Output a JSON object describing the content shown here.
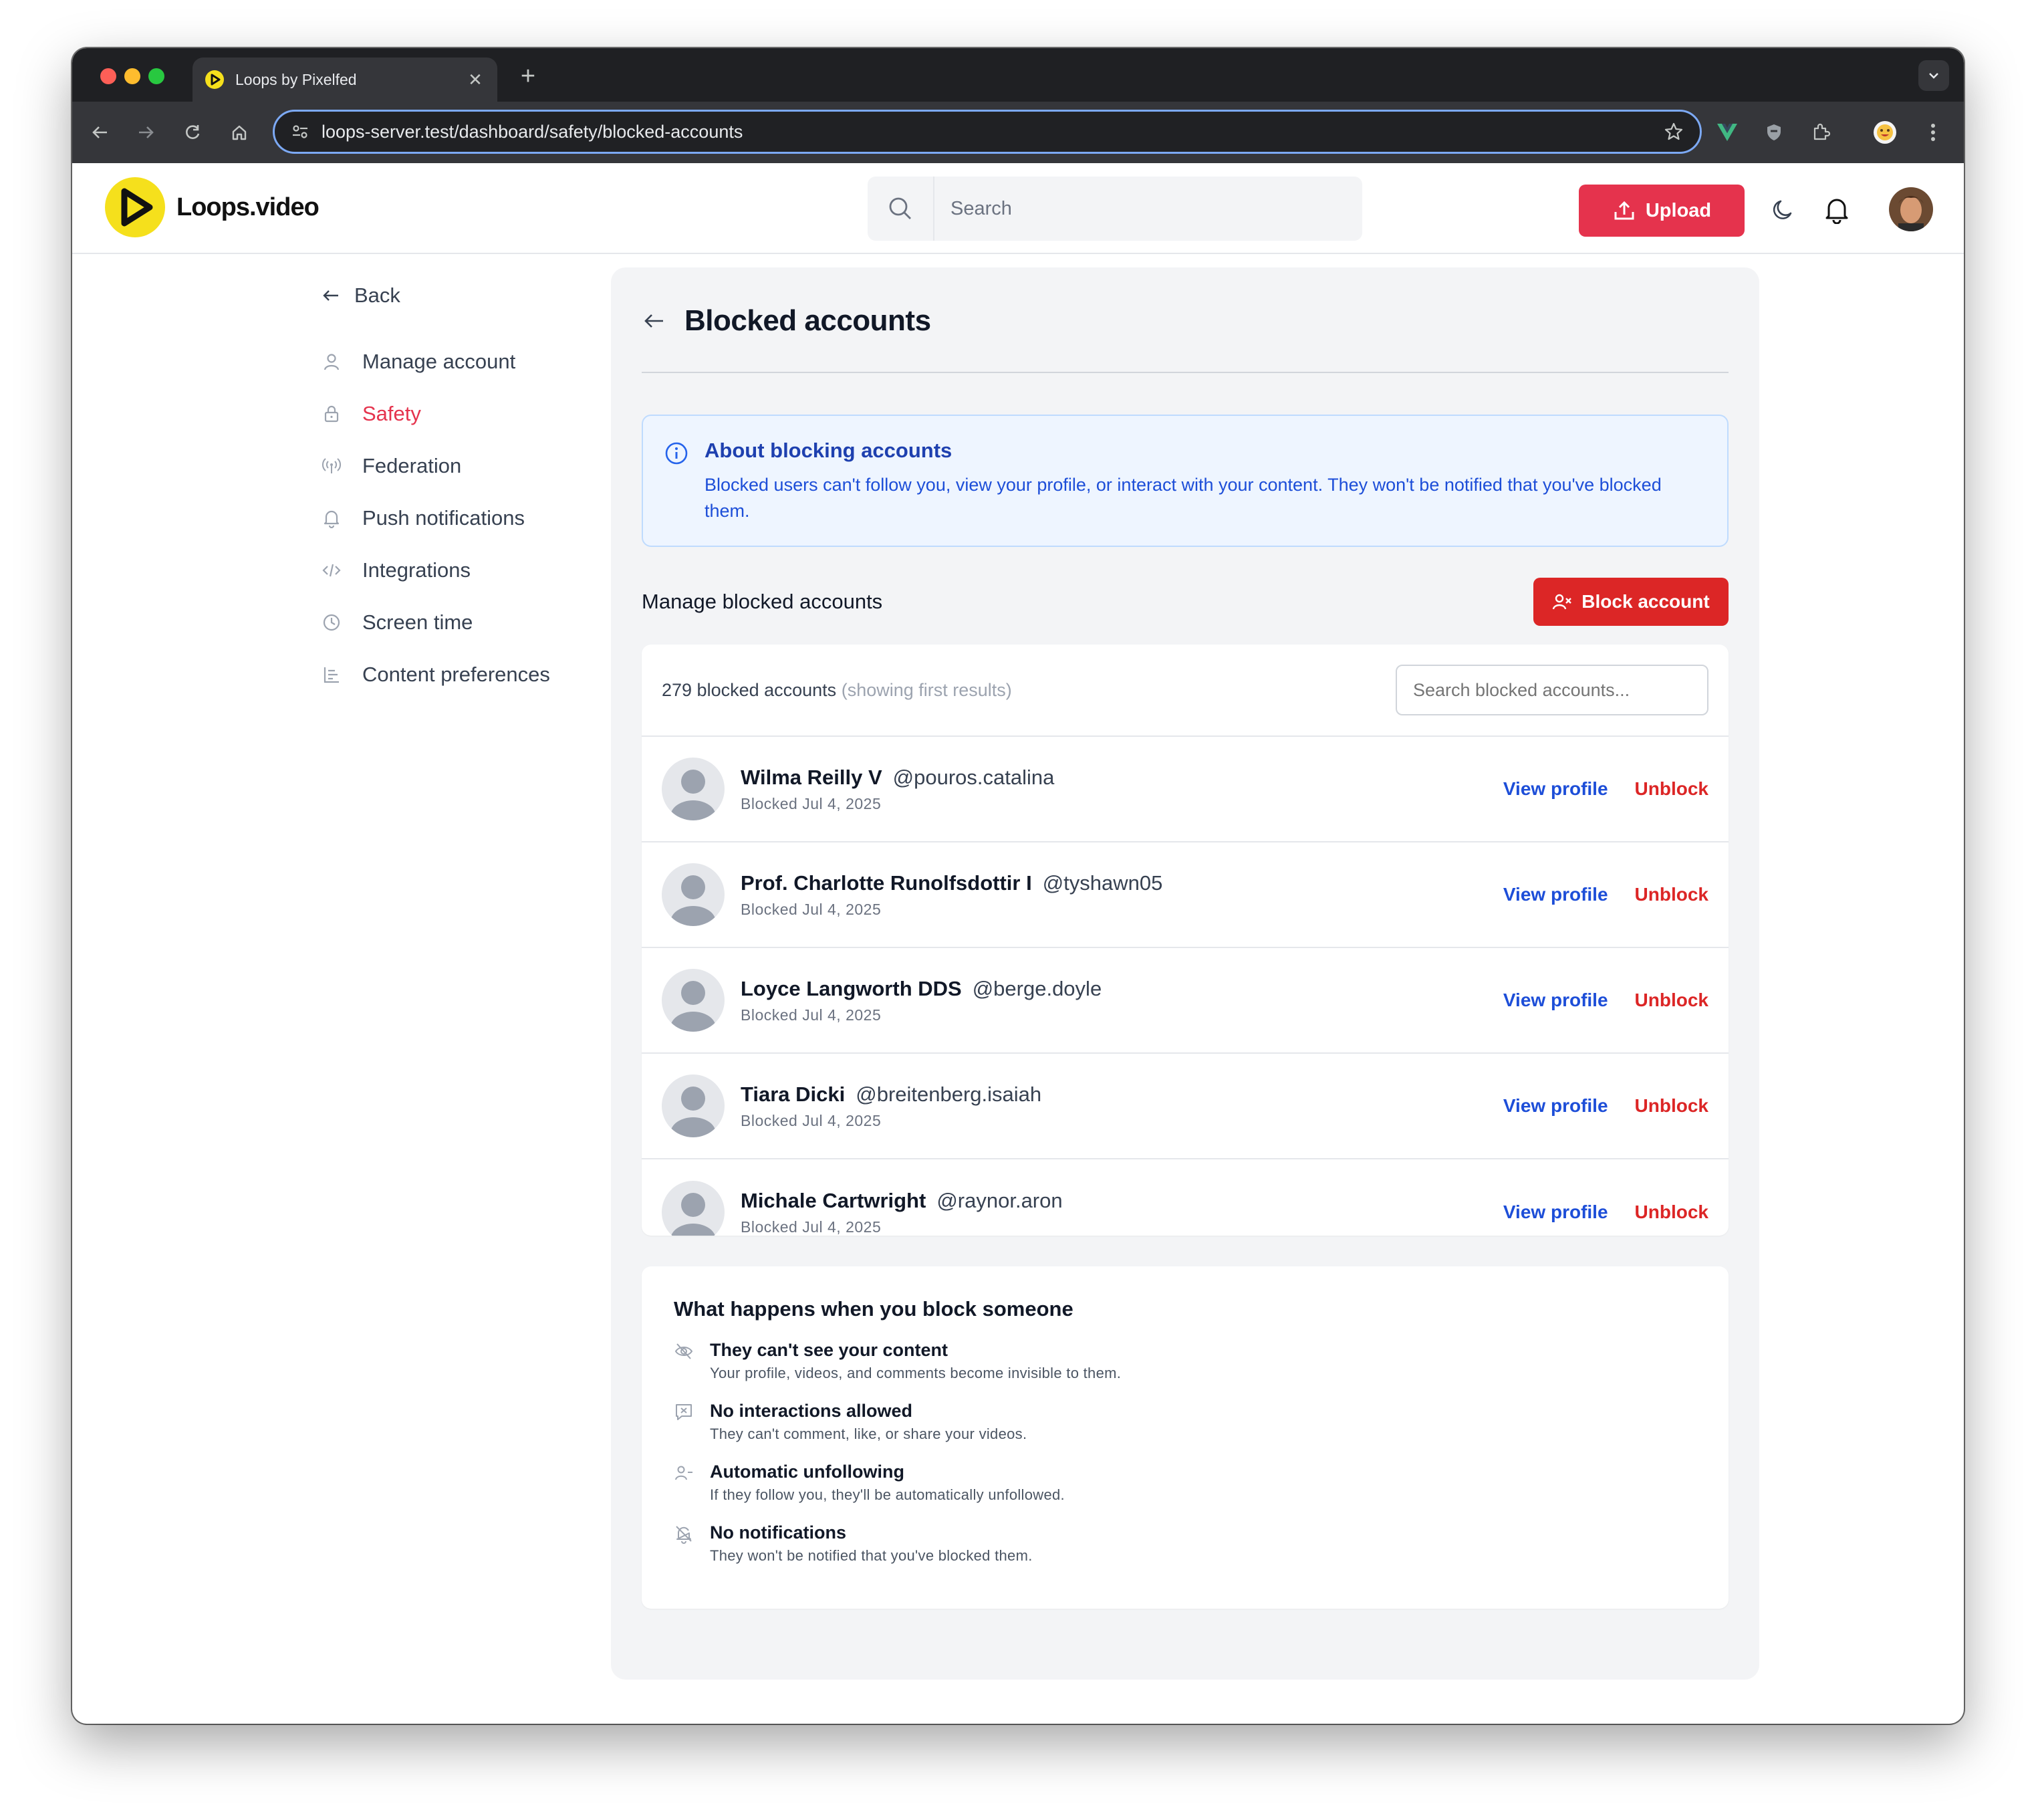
{
  "browser": {
    "tab_title": "Loops by Pixelfed",
    "url": "loops-server.test/dashboard/safety/blocked-accounts"
  },
  "header": {
    "logo_text": "Loops.video",
    "search_placeholder": "Search",
    "upload_label": "Upload"
  },
  "sidebar": {
    "back_label": "Back",
    "items": [
      {
        "label": "Manage account",
        "icon": "user-icon",
        "active": false
      },
      {
        "label": "Safety",
        "icon": "lock-icon",
        "active": true
      },
      {
        "label": "Federation",
        "icon": "broadcast-icon",
        "active": false
      },
      {
        "label": "Push notifications",
        "icon": "bell-icon",
        "active": false
      },
      {
        "label": "Integrations",
        "icon": "code-icon",
        "active": false
      },
      {
        "label": "Screen time",
        "icon": "clock-icon",
        "active": false
      },
      {
        "label": "Content preferences",
        "icon": "list-icon",
        "active": false
      }
    ]
  },
  "main": {
    "title": "Blocked accounts",
    "info": {
      "title": "About blocking accounts",
      "text": "Blocked users can't follow you, view your profile, or interact with your content. They won't be notified that you've blocked them."
    },
    "manage_label": "Manage blocked accounts",
    "block_button": "Block account",
    "count_text": "279 blocked accounts",
    "count_note": "(showing first results)",
    "list_search_placeholder": "Search blocked accounts...",
    "view_label": "View profile",
    "unblock_label": "Unblock",
    "accounts": [
      {
        "name": "Wilma Reilly V",
        "handle": "@pouros.catalina",
        "blocked": "Blocked Jul 4, 2025"
      },
      {
        "name": "Prof. Charlotte Runolfsdottir I",
        "handle": "@tyshawn05",
        "blocked": "Blocked Jul 4, 2025"
      },
      {
        "name": "Loyce Langworth DDS",
        "handle": "@berge.doyle",
        "blocked": "Blocked Jul 4, 2025"
      },
      {
        "name": "Tiara Dicki",
        "handle": "@breitenberg.isaiah",
        "blocked": "Blocked Jul 4, 2025"
      },
      {
        "name": "Michale Cartwright",
        "handle": "@raynor.aron",
        "blocked": "Blocked Jul 4, 2025"
      }
    ],
    "what": {
      "title": "What happens when you block someone",
      "items": [
        {
          "title": "They can't see your content",
          "desc": "Your profile, videos, and comments become invisible to them.",
          "icon": "eye-off-icon"
        },
        {
          "title": "No interactions allowed",
          "desc": "They can't comment, like, or share your videos.",
          "icon": "message-x-icon"
        },
        {
          "title": "Automatic unfollowing",
          "desc": "If they follow you, they'll be automatically unfollowed.",
          "icon": "user-minus-icon"
        },
        {
          "title": "No notifications",
          "desc": "They won't be notified that you've blocked them.",
          "icon": "bell-off-icon"
        }
      ]
    }
  },
  "colors": {
    "brand_red": "#e5334d",
    "danger": "#dc2626",
    "link_blue": "#1d4ed8",
    "logo_yellow": "#f5e01c"
  }
}
